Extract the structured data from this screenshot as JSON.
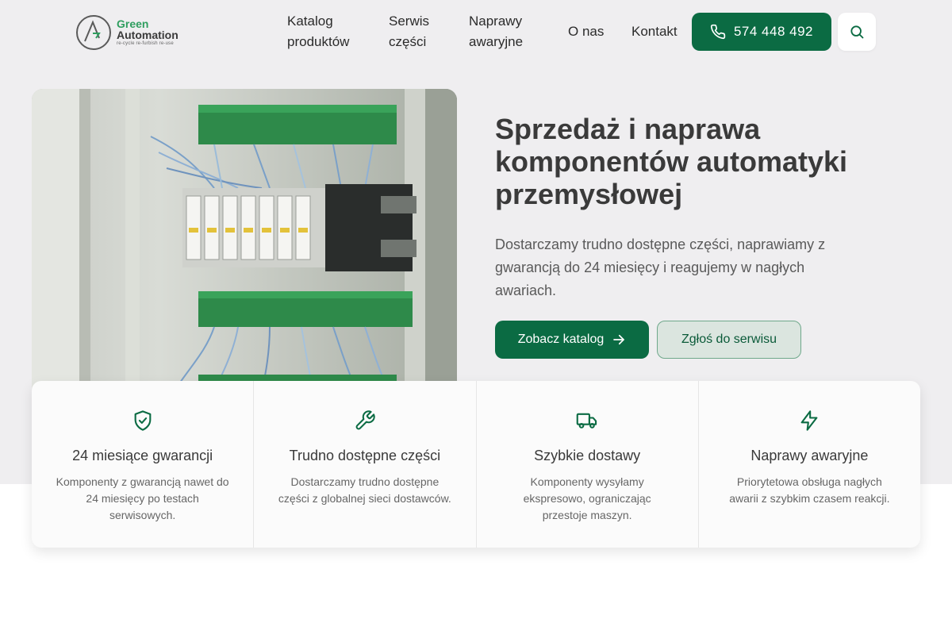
{
  "header": {
    "logo": {
      "line1": "Green",
      "line2": "Automation",
      "tagline": "re-cycle re-furbish re-use"
    },
    "nav": [
      {
        "label": "Katalog\nproduktów"
      },
      {
        "label": "Serwis\nczęści"
      },
      {
        "label": "Naprawy\nawaryjne"
      },
      {
        "label": "O nas"
      },
      {
        "label": "Kontakt"
      }
    ],
    "phone": "574 448 492",
    "search_icon": "search-icon"
  },
  "hero": {
    "title": "Sprzedaż i naprawa komponentów automatyki przemysłowej",
    "description": "Dostarczamy trudno dostępne części, naprawiamy z gwarancją do 24 miesięcy i reagujemy w nagłych awariach.",
    "primary_button": "Zobacz katalog",
    "secondary_button": "Zgłoś do serwisu",
    "image": "industrial-control-cabinet-photo"
  },
  "features": [
    {
      "icon": "shield-check-icon",
      "title": "24 miesiące gwarancji",
      "desc": "Komponenty z gwarancją nawet do 24 miesięcy po testach serwisowych."
    },
    {
      "icon": "wrench-icon",
      "title": "Trudno dostępne części",
      "desc": "Dostarczamy trudno dostępne części z globalnej sieci dostawców."
    },
    {
      "icon": "truck-icon",
      "title": "Szybkie dostawy",
      "desc": "Komponenty wysyłamy ekspresowo, ograniczając przestoje maszyn."
    },
    {
      "icon": "lightning-icon",
      "title": "Naprawy awaryjne",
      "desc": "Priorytetowa obsługa nagłych awarii z szybkim czasem reakcji."
    }
  ],
  "colors": {
    "brand": "#0b6b43",
    "logo_green": "#2f9e5f",
    "page_bg": "#efeef0"
  }
}
